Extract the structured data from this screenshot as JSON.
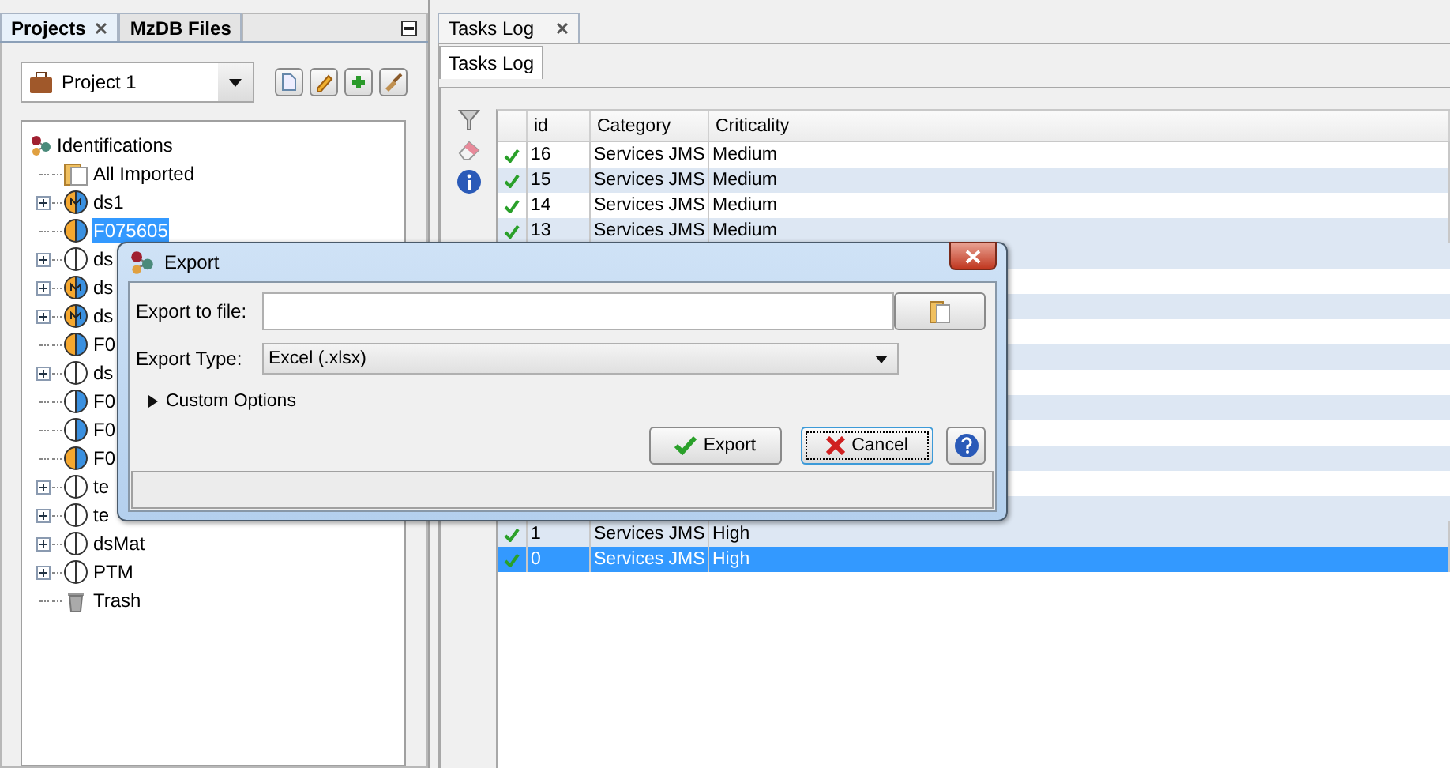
{
  "left_panel": {
    "tabs": [
      {
        "label": "Projects",
        "selected": true,
        "closable": true
      },
      {
        "label": "MzDB Files",
        "selected": false,
        "closable": false
      }
    ],
    "project_selector": {
      "value": "Project 1"
    },
    "tree": {
      "label": "Identifications",
      "children": [
        {
          "label": "All Imported",
          "kind": "folder",
          "expandable": false,
          "selected": false
        },
        {
          "label": "ds1",
          "kind": "merged",
          "expandable": true,
          "selected": false
        },
        {
          "label": "F075605",
          "kind": "mixed",
          "expandable": false,
          "selected": true
        },
        {
          "label": "ds",
          "kind": "plain",
          "expandable": true,
          "selected": false
        },
        {
          "label": "ds",
          "kind": "merged",
          "expandable": true,
          "selected": false
        },
        {
          "label": "ds",
          "kind": "merged",
          "expandable": true,
          "selected": false
        },
        {
          "label": "F0",
          "kind": "mixed",
          "expandable": false,
          "selected": false
        },
        {
          "label": "ds",
          "kind": "plain",
          "expandable": true,
          "selected": false
        },
        {
          "label": "F0",
          "kind": "blue",
          "expandable": false,
          "selected": false
        },
        {
          "label": "F0",
          "kind": "blue",
          "expandable": false,
          "selected": false
        },
        {
          "label": "F0",
          "kind": "mixed",
          "expandable": false,
          "selected": false
        },
        {
          "label": "te",
          "kind": "plain",
          "expandable": true,
          "selected": false
        },
        {
          "label": "te",
          "kind": "plain",
          "expandable": true,
          "selected": false
        },
        {
          "label": "dsMat",
          "kind": "plain",
          "expandable": true,
          "selected": false
        },
        {
          "label": "PTM",
          "kind": "plain",
          "expandable": true,
          "selected": false
        },
        {
          "label": "Trash",
          "kind": "trash",
          "expandable": false,
          "selected": false
        }
      ]
    }
  },
  "right_panel": {
    "tab": {
      "label": "Tasks Log",
      "closable": true
    },
    "inner_tab": {
      "label": "Tasks Log",
      "selected": true
    },
    "table": {
      "columns": [
        "id",
        "Category",
        "Criticality"
      ],
      "rows_top": [
        {
          "id": "16",
          "category": "Services JMS",
          "criticality": "Medium",
          "selected": false
        },
        {
          "id": "15",
          "category": "Services JMS",
          "criticality": "Medium",
          "selected": false
        },
        {
          "id": "14",
          "category": "Services JMS",
          "criticality": "Medium",
          "selected": false
        },
        {
          "id": "13",
          "category": "Services JMS",
          "criticality": "Medium",
          "selected": false
        }
      ],
      "rows_bottom": [
        {
          "id": "1",
          "category": "Services JMS",
          "criticality": "High",
          "selected": false
        },
        {
          "id": "0",
          "category": "Services JMS",
          "criticality": "High",
          "selected": true
        }
      ]
    }
  },
  "dialog": {
    "title": "Export",
    "file_field": {
      "label": "Export to file:"
    },
    "type_field": {
      "label": "Export Type:",
      "value": "Excel (.xlsx)"
    },
    "custom_options": {
      "label": "Custom Options",
      "expanded": false
    },
    "buttons": [
      {
        "label": "Export",
        "kind": "ok",
        "focused": false
      },
      {
        "label": "Cancel",
        "kind": "cancel",
        "focused": true
      }
    ]
  }
}
